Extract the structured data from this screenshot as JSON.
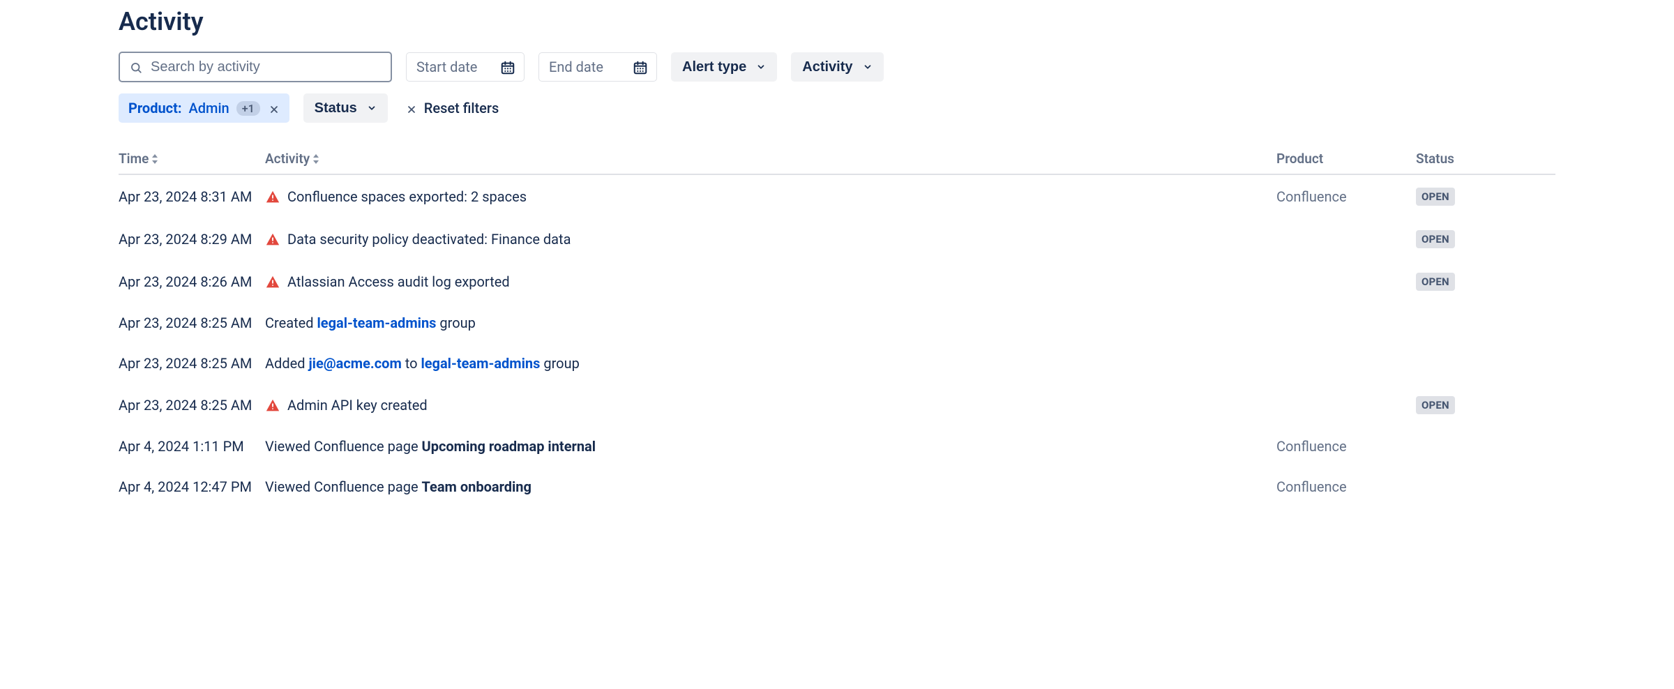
{
  "title": "Activity",
  "controls": {
    "search_placeholder": "Search by activity",
    "start_date_placeholder": "Start date",
    "end_date_placeholder": "End date",
    "alert_type_label": "Alert type",
    "activity_label": "Activity",
    "status_label": "Status",
    "reset_label": "Reset filters",
    "product_filter": {
      "label": "Product:",
      "value": "Admin",
      "extra_count": "+1"
    }
  },
  "columns": {
    "time": "Time",
    "activity": "Activity",
    "product": "Product",
    "status": "Status"
  },
  "status_open": "OPEN",
  "rows": [
    {
      "time": "Apr 23, 2024 8:31 AM",
      "alert": true,
      "segments": [
        {
          "t": "Confluence spaces exported: 2 spaces"
        }
      ],
      "product": "Confluence",
      "status": "OPEN"
    },
    {
      "time": "Apr 23, 2024 8:29 AM",
      "alert": true,
      "segments": [
        {
          "t": "Data security policy deactivated: Finance data"
        }
      ],
      "product": "",
      "status": "OPEN"
    },
    {
      "time": "Apr 23, 2024 8:26 AM",
      "alert": true,
      "segments": [
        {
          "t": "Atlassian Access audit log exported"
        }
      ],
      "product": "",
      "status": "OPEN"
    },
    {
      "time": "Apr 23, 2024 8:25 AM",
      "alert": false,
      "segments": [
        {
          "t": "Created "
        },
        {
          "t": "legal-team-admins",
          "link": true
        },
        {
          "t": " group"
        }
      ],
      "product": "",
      "status": ""
    },
    {
      "time": "Apr 23, 2024 8:25 AM",
      "alert": false,
      "segments": [
        {
          "t": "Added "
        },
        {
          "t": "jie@acme.com",
          "link": true
        },
        {
          "t": " to "
        },
        {
          "t": "legal-team-admins",
          "link": true
        },
        {
          "t": " group"
        }
      ],
      "product": "",
      "status": ""
    },
    {
      "time": "Apr 23, 2024 8:25 AM",
      "alert": true,
      "segments": [
        {
          "t": "Admin API key created"
        }
      ],
      "product": "",
      "status": "OPEN"
    },
    {
      "time": "Apr 4, 2024 1:11 PM",
      "alert": false,
      "segments": [
        {
          "t": "Viewed Confluence page "
        },
        {
          "t": "Upcoming roadmap internal",
          "bold": true
        }
      ],
      "product": "Confluence",
      "status": ""
    },
    {
      "time": "Apr 4, 2024 12:47 PM",
      "alert": false,
      "segments": [
        {
          "t": "Viewed Confluence page "
        },
        {
          "t": "Team onboarding",
          "bold": true
        }
      ],
      "product": "Confluence",
      "status": ""
    }
  ]
}
